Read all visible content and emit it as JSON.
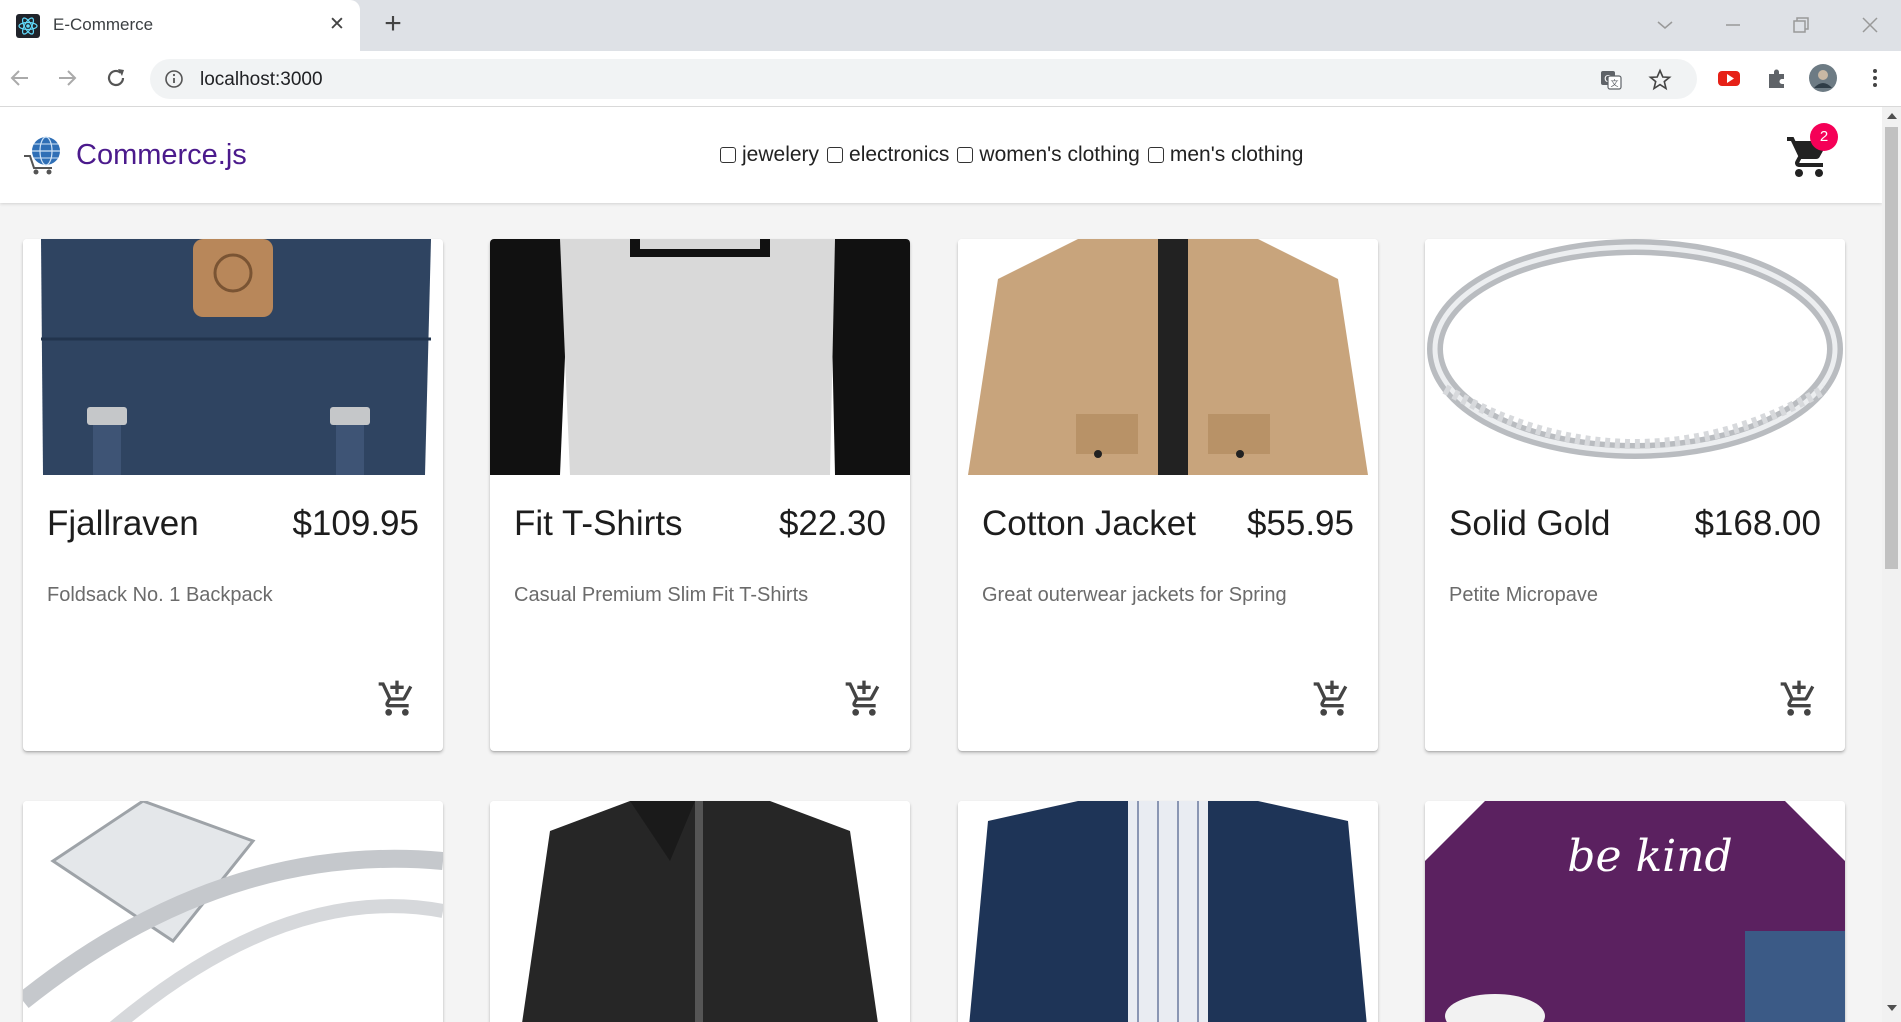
{
  "browser": {
    "tab_title": "E-Commerce",
    "url": "localhost:3000"
  },
  "app": {
    "brand": "Commerce.js",
    "filters": [
      "jewelery",
      "electronics",
      "women's clothing",
      "men's clothing"
    ],
    "cart_count": "2"
  },
  "products": [
    {
      "title": "Fjallraven",
      "price": "$109.95",
      "description": "Foldsack No. 1 Backpack",
      "image": "navy backpack"
    },
    {
      "title": "Fit T-Shirts",
      "price": "$22.30",
      "description": "Casual Premium Slim Fit T-Shirts",
      "image": "raglan t-shirt"
    },
    {
      "title": "Cotton Jacket",
      "price": "$55.95",
      "description": "Great outerwear jackets for Spring",
      "image": "khaki jacket"
    },
    {
      "title": "Solid Gold",
      "price": "$168.00",
      "description": "Petite Micropave",
      "image": "silver band ring"
    },
    {
      "title": "",
      "price": "",
      "description": "",
      "image": "diamond ring set"
    },
    {
      "title": "",
      "price": "",
      "description": "",
      "image": "black leather jacket"
    },
    {
      "title": "",
      "price": "",
      "description": "",
      "image": "navy rain jacket"
    },
    {
      "title": "",
      "price": "",
      "description": "",
      "image": "purple t-shirt",
      "image_text": "be kind"
    }
  ]
}
